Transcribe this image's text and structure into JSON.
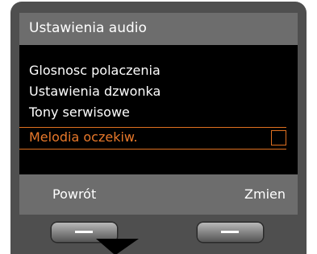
{
  "screen": {
    "title": "Ustawienia audio",
    "menu_items": [
      {
        "label": "Glosnosc polaczenia"
      },
      {
        "label": "Ustawienia dzwonka"
      },
      {
        "label": "Tony serwisowe"
      },
      {
        "label": "Melodia oczekiw.",
        "selected": true,
        "checked": false
      }
    ]
  },
  "softkeys": {
    "left": "Powrót",
    "right": "Zmien"
  },
  "colors": {
    "housing": "#4f4f4f",
    "screen_background": "#000000",
    "bar_background": "#6d6d6d",
    "highlight": "#e07020"
  },
  "icons": {
    "pointer": "arrow-pointer-icon",
    "left_button": "dash-icon",
    "right_button": "dash-icon"
  }
}
